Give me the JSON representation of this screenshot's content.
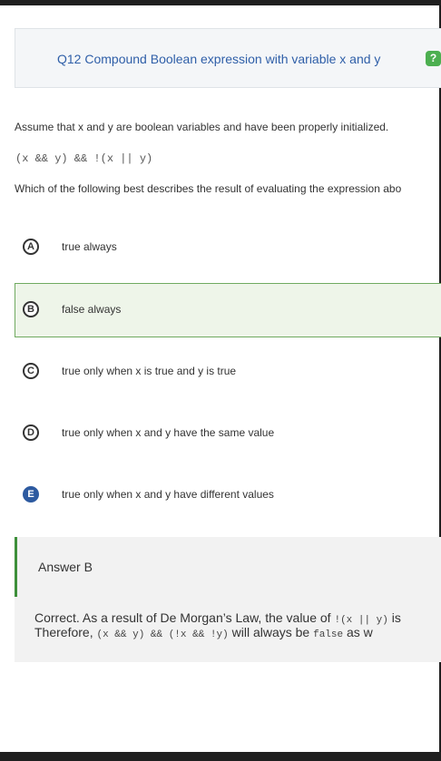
{
  "question": {
    "title": "Q12 Compound Boolean expression with variable x and y",
    "help_icon_glyph": "?",
    "intro": "Assume that x and y are boolean variables and have been properly initialized.",
    "code": "(x && y) && !(x || y)",
    "prompt": "Which of the following best describes the result of evaluating the expression abo"
  },
  "options": [
    {
      "letter": "A",
      "text": "true always"
    },
    {
      "letter": "B",
      "text": "false always"
    },
    {
      "letter": "C",
      "text": "true only when x is true and y is true"
    },
    {
      "letter": "D",
      "text": "true only when x and y have the same value"
    },
    {
      "letter": "E",
      "text": "true only when x and y have different values"
    }
  ],
  "selected_option": "B",
  "answer": {
    "title": "Answer B",
    "line1_prefix": "Correct. As a result of De Morgan’s Law, the value of ",
    "line1_code": "!(x || y)",
    "line1_suffix": " is",
    "line2_prefix": "Therefore, ",
    "line2_code1": "(x && y) && (!x && !y)",
    "line2_mid": " will always be ",
    "line2_code2": "false",
    "line2_suffix": " as w"
  },
  "colors": {
    "title_blue": "#2f5fa8",
    "selected_border": "#6faa60",
    "answer_bar": "#3d8f3a",
    "help_green": "#4caf50"
  }
}
